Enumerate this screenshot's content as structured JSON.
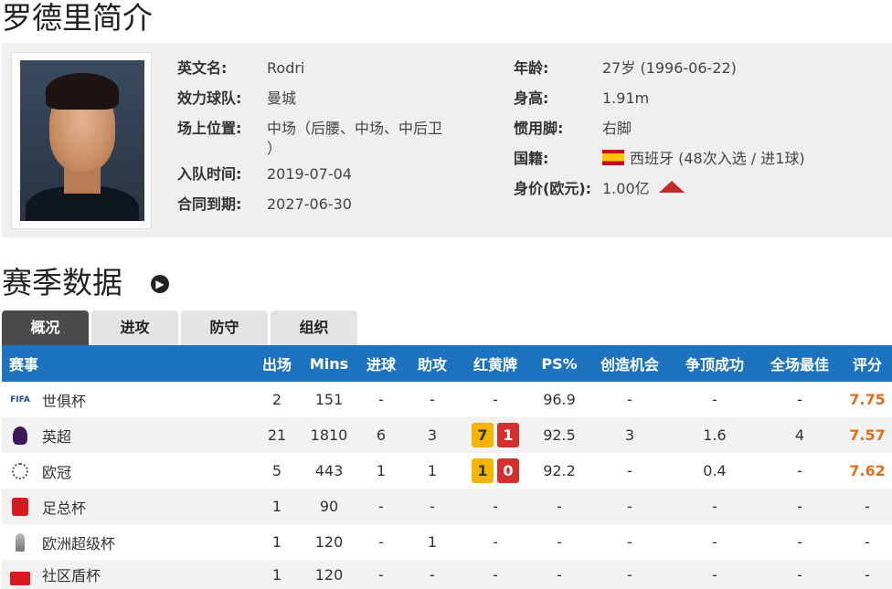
{
  "page_title": "罗德里简介",
  "profile": {
    "left": [
      {
        "label": "英文名:",
        "value": "Rodri"
      },
      {
        "label": "效力球队:",
        "value": "曼城"
      },
      {
        "label": "场上位置:",
        "value": "中场（后腰、中场、中后卫",
        "value_cont": "）"
      },
      {
        "label": "入队时间:",
        "value": "2019-07-04"
      },
      {
        "label": "合同到期:",
        "value": "2027-06-30"
      }
    ],
    "right": [
      {
        "label": "年龄:",
        "value": "27岁 (1996-06-22)"
      },
      {
        "label": "身高:",
        "value": "1.91m"
      },
      {
        "label": "惯用脚:",
        "value": "右脚"
      },
      {
        "label": "国籍:",
        "value": "西班牙 (48次入选 / 进1球)"
      },
      {
        "label": "身价(欧元):",
        "value": "1.00亿"
      }
    ],
    "flag_icon": "spain-flag-icon",
    "trend_icon": "up-arrow-icon",
    "trend_color": "#c62828"
  },
  "section_title": "赛季数据",
  "tabs": [
    "概况",
    "进攻",
    "防守",
    "组织"
  ],
  "active_tab": 0,
  "table": {
    "headers": [
      "赛事",
      "出场",
      "Mins",
      "进球",
      "助攻",
      "红黄牌",
      "PS%",
      "创造机会",
      "争顶成功",
      "全场最佳",
      "评分"
    ],
    "rows": [
      {
        "comp": "世俱杯",
        "icon": "fifa-icon",
        "apps": "2",
        "mins": "151",
        "goals": "-",
        "assists": "-",
        "yellow": "",
        "red": "",
        "cards": "-",
        "ps": "96.9",
        "chances": "-",
        "aerial": "-",
        "motm": "-",
        "rating": "7.75"
      },
      {
        "comp": "英超",
        "icon": "premier-league-icon",
        "apps": "21",
        "mins": "1810",
        "goals": "6",
        "assists": "3",
        "yellow": "7",
        "red": "1",
        "cards": "",
        "ps": "92.5",
        "chances": "3",
        "aerial": "1.6",
        "motm": "4",
        "rating": "7.57"
      },
      {
        "comp": "欧冠",
        "icon": "champions-league-icon",
        "apps": "5",
        "mins": "443",
        "goals": "1",
        "assists": "1",
        "yellow": "1",
        "red": "0",
        "cards": "",
        "ps": "92.2",
        "chances": "-",
        "aerial": "0.4",
        "motm": "-",
        "rating": "7.62"
      },
      {
        "comp": "足总杯",
        "icon": "fa-cup-icon",
        "apps": "1",
        "mins": "90",
        "goals": "-",
        "assists": "-",
        "yellow": "",
        "red": "",
        "cards": "-",
        "ps": "-",
        "chances": "-",
        "aerial": "-",
        "motm": "-",
        "rating": "-"
      },
      {
        "comp": "欧洲超级杯",
        "icon": "uefa-super-cup-icon",
        "apps": "1",
        "mins": "120",
        "goals": "-",
        "assists": "1",
        "yellow": "",
        "red": "",
        "cards": "-",
        "ps": "-",
        "chances": "-",
        "aerial": "-",
        "motm": "-",
        "rating": "-"
      },
      {
        "comp": "社区盾杯",
        "icon": "community-shield-icon",
        "apps": "1",
        "mins": "120",
        "goals": "-",
        "assists": "-",
        "yellow": "",
        "red": "",
        "cards": "-",
        "ps": "-",
        "chances": "-",
        "aerial": "-",
        "motm": "-",
        "rating": "-"
      }
    ]
  },
  "colors": {
    "header_bg": "#1e73be",
    "rating": "#e06d1a",
    "yellow_card": "#f5b400",
    "red_card": "#d32f2f"
  }
}
